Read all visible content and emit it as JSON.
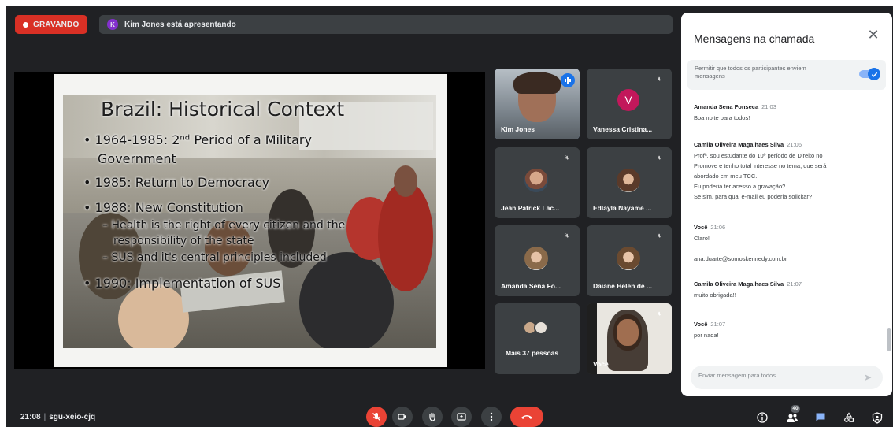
{
  "recording": {
    "label": "GRAVANDO"
  },
  "presenter": {
    "initial": "K",
    "text": "Kim Jones está apresentando"
  },
  "slide": {
    "title": "Brazil: Historical Context",
    "bullets": [
      "• 1964-1985: 2ⁿᵈ Period of a Military",
      "Government",
      "• 1985: Return to Democracy",
      "• 1988: New Constitution",
      "– Health is the right of every citizen and the",
      "responsibility of the state",
      "– SUS and it's central principles included",
      "• 1990: Implementation of SUS"
    ]
  },
  "tiles": [
    {
      "name": "Kim Jones"
    },
    {
      "name": "Vanessa Cristina...",
      "initial": "V",
      "color": "#c2185b"
    },
    {
      "name": "Jean Patrick Lac..."
    },
    {
      "name": "Edlayla Nayame ..."
    },
    {
      "name": "Amanda Sena Fo..."
    },
    {
      "name": "Daiane Helen de ..."
    },
    {
      "name": "Mais 37 pessoas"
    },
    {
      "name": "Você"
    }
  ],
  "chat": {
    "title": "Mensagens na chamada",
    "permit_text": "Permitir que todos os participantes enviem mensagens",
    "messages": [
      {
        "author": "Amanda Sena Fonseca",
        "time": "21:03",
        "lines": [
          "Boa noite para todos!"
        ]
      },
      {
        "author": "Camila Oliveira Magalhaes Silva",
        "time": "21:06",
        "lines": [
          "Profª, sou estudante do 10º período de Direito no",
          "Promove e tenho total interesse no tema, que será",
          "abordado em meu TCC..",
          "Eu poderia ter acesso a gravação?",
          "Se sim, para qual e-mail eu poderia solicitar?"
        ]
      },
      {
        "author": "Você",
        "time": "21:06",
        "lines": [
          "Claro!",
          "",
          "ana.duarte@somoskennedy.com.br"
        ]
      },
      {
        "author": "Camila Oliveira Magalhaes Silva",
        "time": "21:07",
        "lines": [
          "muito obrigada!!"
        ]
      },
      {
        "author": "Você",
        "time": "21:07",
        "lines": [
          "por nada!"
        ]
      }
    ],
    "input_placeholder": "Enviar mensagem para todos"
  },
  "bottom": {
    "time": "21:08",
    "meeting_code": "sgu-xeio-cjq",
    "people_count": "40"
  },
  "colors": {
    "record": "#d93025",
    "accent": "#1a73e8",
    "end_call": "#ea4335",
    "bar_bg": "#202124"
  },
  "icons": [
    "mic-off-icon",
    "camera-icon",
    "hand-raise-icon",
    "present-icon",
    "more-icon",
    "end-call-icon",
    "info-icon",
    "people-icon",
    "chat-icon",
    "activities-icon",
    "shield-icon",
    "close-icon",
    "send-icon"
  ]
}
